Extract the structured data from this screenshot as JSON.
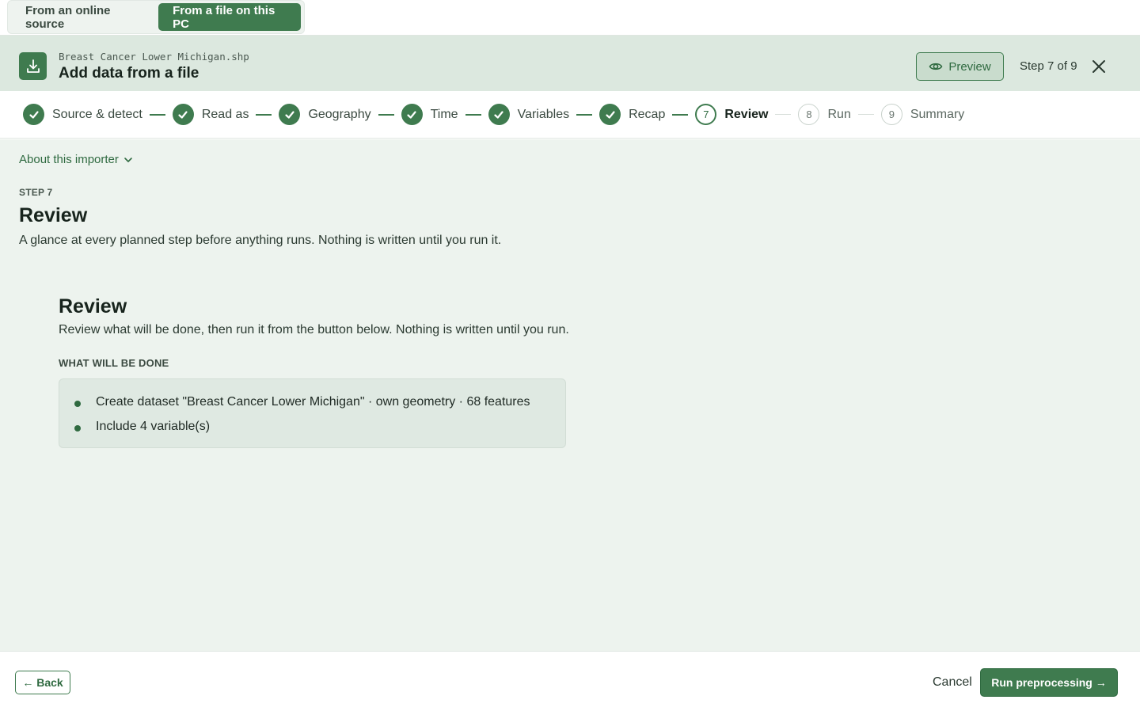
{
  "source_tabs": {
    "online": "From an online source",
    "file": "From a file on this PC"
  },
  "header": {
    "file_name": "Breast Cancer Lower Michigan.shp",
    "title": "Add data from a file",
    "preview_label": "Preview",
    "step_count": "Step 7 of 9",
    "import_icon": "download-tray-icon",
    "preview_icon": "eye-icon",
    "close_icon": "close-icon"
  },
  "stepper": {
    "steps": [
      {
        "label": "Source & detect",
        "status": "done"
      },
      {
        "label": "Read as",
        "status": "done"
      },
      {
        "label": "Geography",
        "status": "done"
      },
      {
        "label": "Time",
        "status": "done"
      },
      {
        "label": "Variables",
        "status": "done"
      },
      {
        "label": "Recap",
        "status": "done"
      },
      {
        "label": "Review",
        "status": "current",
        "number": "7"
      },
      {
        "label": "Run",
        "status": "todo",
        "number": "8"
      },
      {
        "label": "Summary",
        "status": "todo",
        "number": "9"
      }
    ]
  },
  "main": {
    "about_label": "About this importer",
    "step_eyebrow": "STEP 7",
    "title": "Review",
    "subtitle": "A glance at every planned step before anything runs. Nothing is written until you run it.",
    "review": {
      "title": "Review",
      "description": "Review what will be done, then run it from the button below. Nothing is written until you run.",
      "section_label": "WHAT WILL BE DONE",
      "items": [
        "Create dataset \"Breast Cancer Lower Michigan\" · own geometry · 68 features",
        "Include 4 variable(s)"
      ]
    }
  },
  "footer": {
    "back_label": "← Back",
    "cancel_label": "Cancel",
    "run_label": "Run preprocessing →"
  },
  "colors": {
    "accent": "#3f7b4f",
    "header_bg": "#dce8df",
    "main_bg": "#edf3ee"
  }
}
